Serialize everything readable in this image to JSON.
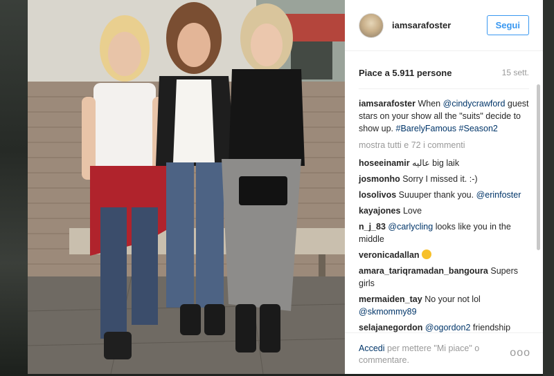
{
  "post": {
    "username": "iamsarafoster",
    "follow_label": "Segui",
    "likes": "Piace a 5.911 persone",
    "timestamp": "15 sett.",
    "caption": {
      "author": "iamsarafoster",
      "text_1": "When",
      "mention": "@cindycrawford",
      "text_2": "guest stars on your show all the \"suits\" decide to show up.",
      "tag_1": "#BarelyFamous",
      "tag_2": "#Season2"
    },
    "load_more": "mostra tutti e 72 i commenti"
  },
  "comments": [
    {
      "author": "hoseeinamir",
      "text": "عالیه big laik"
    },
    {
      "author": "josmonho",
      "text": "Sorry I missed it. :-)"
    },
    {
      "author": "losolivos",
      "text": "Suuuper thank you.",
      "mention": "@erinfoster"
    },
    {
      "author": "kayajones",
      "text": "Love"
    },
    {
      "author": "n_j_83",
      "mention": "@carlycling",
      "text": "looks like you in the middle"
    },
    {
      "author": "veronicadallan",
      "emoji": "heart-eyes-emoji"
    },
    {
      "author": "amara_tariqramadan_bangoura",
      "text": "Supers girls"
    },
    {
      "author": "mermaiden_tay",
      "text": "No your not lol",
      "mention": "@skmommy89"
    },
    {
      "author": "selajanegordon",
      "mention": "@ogordon2",
      "text": "friendship goals"
    }
  ],
  "footer": {
    "login_link": "Accedi",
    "login_text": "per mettere \"Mi piace\" o commentare.",
    "more_icon": "more-options-icon",
    "more_glyph": "ooo"
  },
  "colors": {
    "accent": "#3897f0",
    "link": "#003569",
    "muted": "#999999"
  }
}
